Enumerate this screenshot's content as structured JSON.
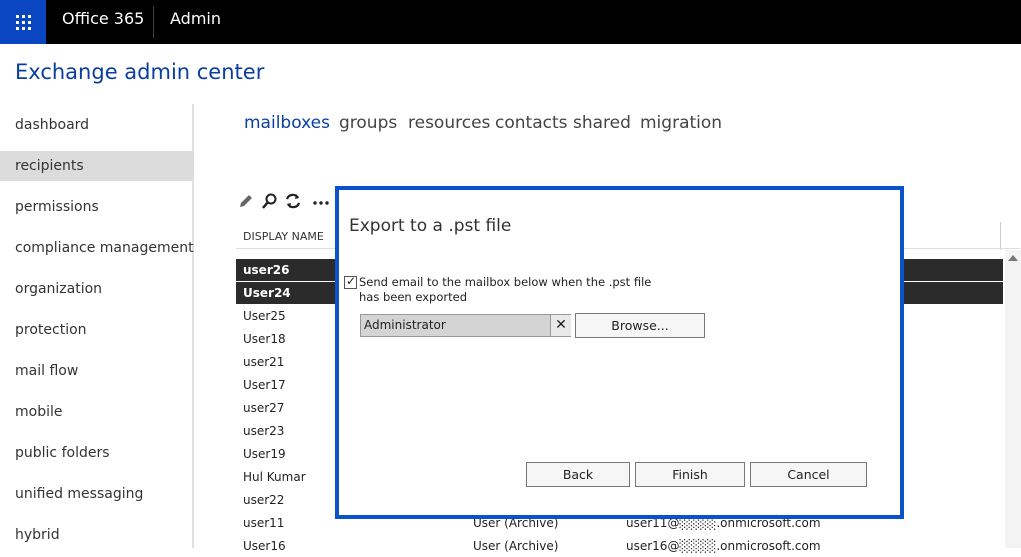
{
  "topbar": {
    "brand": "Office 365",
    "section": "Admin"
  },
  "app_title": "Exchange admin center",
  "sidebar": {
    "items": [
      {
        "label": "dashboard"
      },
      {
        "label": "recipients"
      },
      {
        "label": "permissions"
      },
      {
        "label": "compliance management"
      },
      {
        "label": "organization"
      },
      {
        "label": "protection"
      },
      {
        "label": "mail flow"
      },
      {
        "label": "mobile"
      },
      {
        "label": "public folders"
      },
      {
        "label": "unified messaging"
      },
      {
        "label": "hybrid"
      }
    ],
    "active": "recipients"
  },
  "tabs": [
    {
      "label": "mailboxes"
    },
    {
      "label": "groups"
    },
    {
      "label": "resources"
    },
    {
      "label": "contacts"
    },
    {
      "label": "shared"
    },
    {
      "label": "migration"
    }
  ],
  "toolbar": {
    "icons": [
      "pencil-icon",
      "search-icon",
      "refresh-icon",
      "more-icon"
    ]
  },
  "table": {
    "column_header": "DISPLAY NAME",
    "rows": [
      {
        "name": "user26",
        "type": "",
        "email": "",
        "selected": true
      },
      {
        "name": "User24",
        "type": "",
        "email": "",
        "selected": true
      },
      {
        "name": "User25",
        "type": "",
        "email": ""
      },
      {
        "name": "User18",
        "type": "",
        "email": ""
      },
      {
        "name": "user21",
        "type": "",
        "email": ""
      },
      {
        "name": "User17",
        "type": "",
        "email": ""
      },
      {
        "name": "user27",
        "type": "",
        "email": ""
      },
      {
        "name": "user23",
        "type": "",
        "email": ""
      },
      {
        "name": "User19",
        "type": "",
        "email": ""
      },
      {
        "name": "Hul Kumar",
        "type": "",
        "email": ""
      },
      {
        "name": "user22",
        "type": "",
        "email": ""
      },
      {
        "name": "user11",
        "type": "User (Archive)",
        "email": "user11@░░░░.onmicrosoft.com"
      },
      {
        "name": "User16",
        "type": "User (Archive)",
        "email": "user16@░░░░.onmicrosoft.com"
      }
    ]
  },
  "dialog": {
    "title": "Export to a .pst file",
    "checkbox_checked": true,
    "checkbox_label": "Send email to the mailbox below when the .pst file has been exported",
    "recipient_value": "Administrator",
    "clear_symbol": "✕",
    "browse_label": "Browse...",
    "back_label": "Back",
    "finish_label": "Finish",
    "cancel_label": "Cancel"
  },
  "colors": {
    "accent": "#0a3ea0",
    "dialog_border": "#0a52c9",
    "waffle_bg": "#0a46c2"
  }
}
